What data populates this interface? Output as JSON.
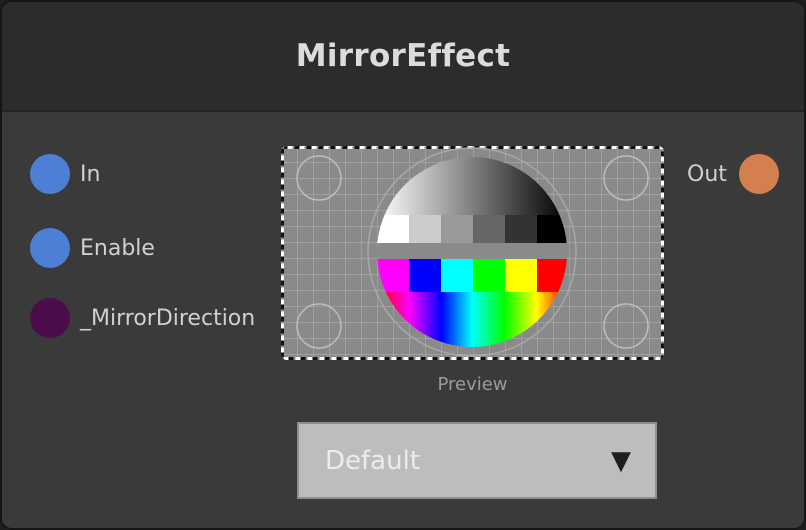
{
  "node": {
    "title": "MirrorEffect",
    "inputs": [
      {
        "label": "In",
        "color": "#4d7fd6"
      },
      {
        "label": "Enable",
        "color": "#4d7fd6"
      },
      {
        "label": "_MirrorDirection",
        "color": "#4a0c4a"
      }
    ],
    "outputs": [
      {
        "label": "Out",
        "color": "#d4804e"
      }
    ],
    "preview": {
      "label": "Preview",
      "image": "test-pattern"
    },
    "dropdown": {
      "selected": "Default",
      "arrow_icon": "triangle-down-icon"
    }
  }
}
